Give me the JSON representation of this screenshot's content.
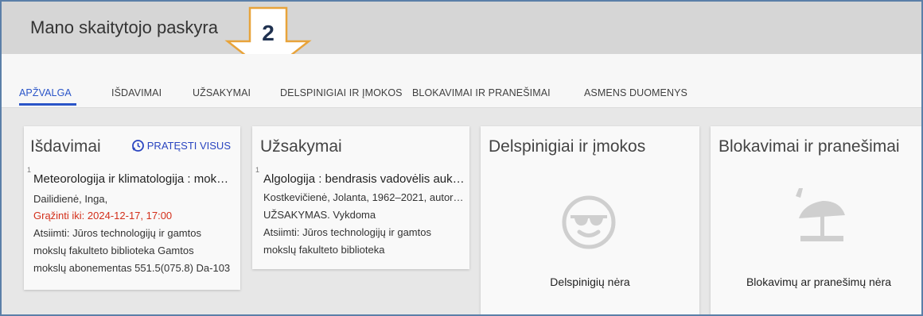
{
  "header": {
    "title": "Mano skaitytojo paskyra",
    "callout_number": "2"
  },
  "tabs": [
    {
      "label": "APŽVALGA",
      "active": true
    },
    {
      "label": "IŠDAVIMAI"
    },
    {
      "label": "UŽSAKYMAI"
    },
    {
      "label": "DELSPINIGIAI IR ĮMOKOS"
    },
    {
      "label": "BLOKAVIMAI IR PRANEŠIMAI"
    },
    {
      "label": "ASMENS DUOMENYS"
    }
  ],
  "loans": {
    "title": "Išdavimai",
    "renew_all_label": "PRATĘSTI VISUS",
    "item": {
      "index": "1",
      "title": "Meteorologija ir klimatologija : mok…",
      "author": "Dailidienė, Inga,",
      "due": "Grąžinti iki: 2024-12-17, 17:00",
      "location_lines": [
        "Atsiimti: Jūros technologijų ir gamtos",
        "mokslų fakulteto biblioteka Gamtos",
        "mokslų abonementas 551.5(075.8) Da-103"
      ]
    }
  },
  "requests": {
    "title": "Užsakymai",
    "item": {
      "index": "1",
      "title": "Algologija : bendrasis vadovėlis auk…",
      "author": "Kostkevičienė, Jolanta, 1962–2021, autor…",
      "status": "UŽSAKYMAS. Vykdoma",
      "location_lines": [
        "Atsiimti: Jūros technologijų ir gamtos",
        "mokslų fakulteto biblioteka"
      ]
    }
  },
  "fines": {
    "title": "Delspinigiai ir įmokos",
    "empty_text": "Delspinigių nėra",
    "icon": "sunglasses-face-icon"
  },
  "blocks": {
    "title": "Blokavimai ir pranešimai",
    "empty_text": "Blokavimų ar pranešimų nėra",
    "icon": "beach-umbrella-icon"
  },
  "colors": {
    "accent": "#2a55c8",
    "due": "#d32f1a",
    "callout_border": "#e8a33a"
  }
}
